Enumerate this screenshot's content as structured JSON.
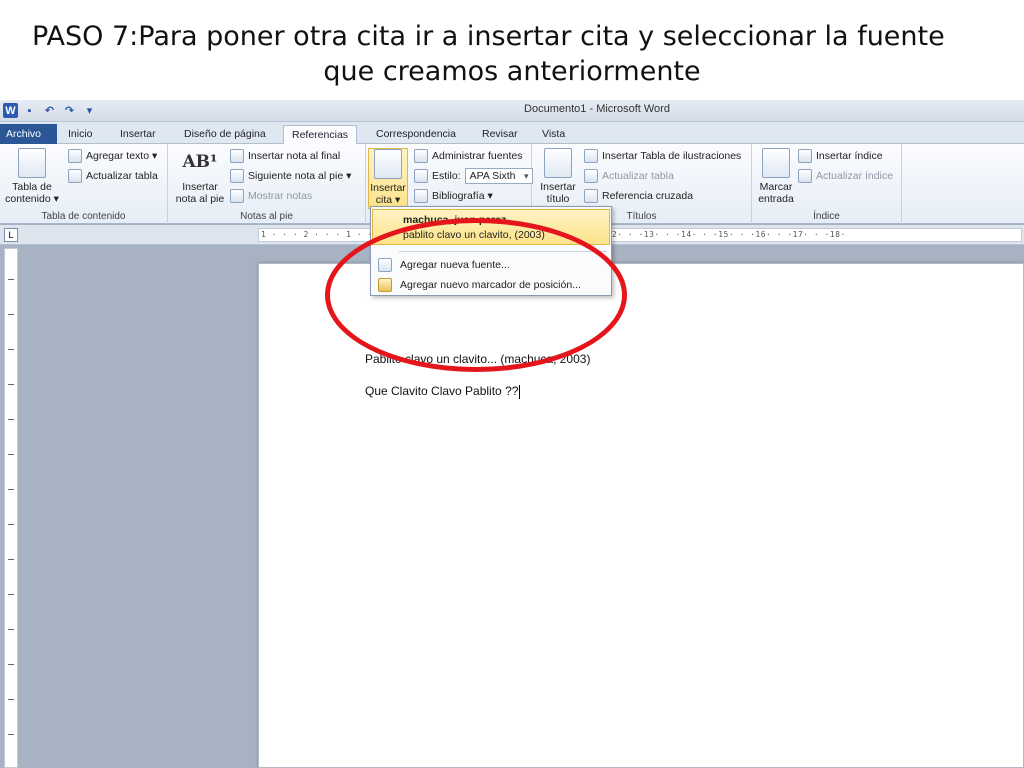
{
  "slide": {
    "title_line1": "PASO 7:Para poner otra cita ir a insertar cita y seleccionar la fuente",
    "title_line2": "que creamos anteriormente"
  },
  "window": {
    "title": "Documento1  -  Microsoft Word",
    "logo": "W"
  },
  "tabs": [
    "Archivo",
    "Inicio",
    "Insertar",
    "Diseño de página",
    "Referencias",
    "Correspondencia",
    "Revisar",
    "Vista"
  ],
  "ribbon": {
    "toc": {
      "big_label_line1": "Tabla de",
      "big_label_line2": "contenido ▾",
      "add_text": "Agregar texto ▾",
      "update_table": "Actualizar tabla",
      "group": "Tabla de contenido"
    },
    "footnotes": {
      "big_icon_text": "AB¹",
      "big_label_line1": "Insertar",
      "big_label_line2": "nota al pie",
      "insert_endnote": "Insertar nota al final",
      "next_footnote": "Siguiente nota al pie ▾",
      "show_notes": "Mostrar notas",
      "group": "Notas al pie"
    },
    "citations": {
      "big_label_line1": "Insertar",
      "big_label_line2": "cita ▾",
      "manage_sources": "Administrar fuentes",
      "style_label": "Estilo:",
      "style_value": "APA Sixth",
      "bibliography": "Bibliografía ▾"
    },
    "captions": {
      "big_label_line1": "Insertar",
      "big_label_line2": "título",
      "insert_table_figures": "Insertar Tabla de ilustraciones",
      "update_table": "Actualizar tabla",
      "cross_reference": "Referencia cruzada",
      "group": "Títulos"
    },
    "index": {
      "big_label_line1": "Marcar",
      "big_label_line2": "entrada",
      "insert_index": "Insertar índice",
      "update_index": "Actualizar índice",
      "group": "Índice"
    }
  },
  "ruler": {
    "horizontal_text": "1 · · · 2 · · · 1 · · ·                       · · 7 · · · 8 · · · 9 · · ·10· · ·11· · ·12· · ·13· · ·14· · ·15· · ·16· · ·17· · ·18·"
  },
  "dropdown": {
    "source_author": "machuca, juan perez",
    "source_title": "pablito clavo un clavito, (2003)",
    "add_source": "Agregar nueva fuente...",
    "add_placeholder": "Agregar nuevo marcador de posición..."
  },
  "document": {
    "line1": "Pablito clavo un clavito... (machuca, 2003)",
    "line2": "Que Clavito Clavo Pablito ??"
  },
  "colors": {
    "highlight": "#e4161b",
    "file_tab": "#2b5797",
    "dropdown_hover": "#fde38a"
  }
}
